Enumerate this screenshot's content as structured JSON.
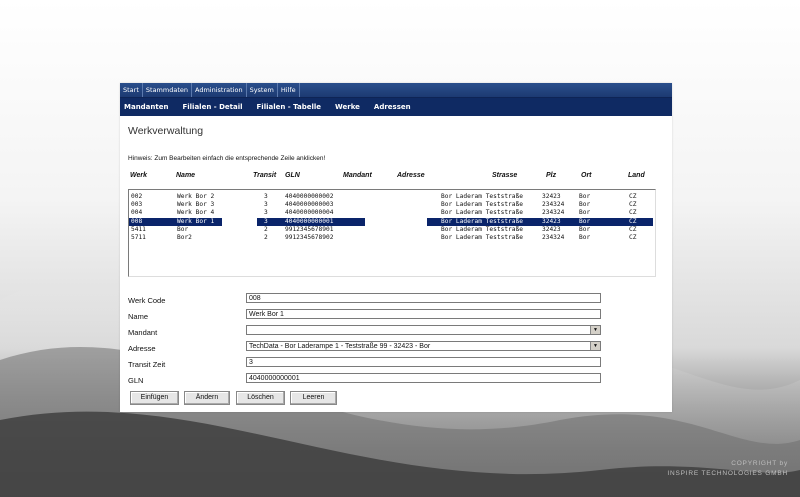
{
  "menu": [
    "Start",
    "Stammdaten",
    "Administration",
    "System",
    "Hilfe"
  ],
  "subnav": [
    "Mandanten",
    "Filialen - Detail",
    "Filialen - Tabelle",
    "Werke",
    "Adressen"
  ],
  "page": {
    "title": "Werkverwaltung",
    "hint": "Hinweis: Zum Bearbeiten einfach die entsprechende Zeile anklicken!"
  },
  "table": {
    "columns": [
      "Werk",
      "Name",
      "Transit",
      "GLN",
      "Mandant",
      "Adresse",
      "Strasse",
      "Plz",
      "Ort",
      "Land"
    ],
    "rows": [
      {
        "werk": "002",
        "name": "Werk Bor 2",
        "transit": "3",
        "gln": "4040000000002",
        "strasse": "Bor Laderam Teststraße",
        "plz": "32423",
        "ort": "Bor",
        "land": "CZ"
      },
      {
        "werk": "003",
        "name": "Werk Bor 3",
        "transit": "3",
        "gln": "4040000000003",
        "strasse": "Bor Laderam Teststraße",
        "plz": "234324",
        "ort": "Bor",
        "land": "CZ"
      },
      {
        "werk": "004",
        "name": "Werk Bor 4",
        "transit": "3",
        "gln": "4040000000004",
        "strasse": "Bor Laderam Teststraße",
        "plz": "234324",
        "ort": "Bor",
        "land": "CZ"
      },
      {
        "werk": "008",
        "name": "Werk Bor 1",
        "transit": "3",
        "gln": "4040000000001",
        "strasse": "Bor Laderam Teststraße",
        "plz": "32423",
        "ort": "Bor",
        "land": "CZ",
        "selected": true
      },
      {
        "werk": "5411",
        "name": "Bor",
        "transit": "2",
        "gln": "9912345678901",
        "strasse": "Bor Laderam Teststraße",
        "plz": "32423",
        "ort": "Bor",
        "land": "CZ"
      },
      {
        "werk": "5711",
        "name": "Bor2",
        "transit": "2",
        "gln": "9912345678902",
        "strasse": "Bor Laderam Teststraße",
        "plz": "234324",
        "ort": "Bor",
        "land": "CZ"
      }
    ]
  },
  "form": {
    "werk_code": {
      "label": "Werk Code",
      "value": "008"
    },
    "name": {
      "label": "Name",
      "value": "Werk Bor 1"
    },
    "mandant": {
      "label": "Mandant",
      "value": ""
    },
    "adresse": {
      "label": "Adresse",
      "value": "TechData - Bor Laderampe 1 - Teststraße 99 - 32423 - Bor"
    },
    "transit": {
      "label": "Transit Zeit",
      "value": "3"
    },
    "gln": {
      "label": "GLN",
      "value": "4040000000001"
    }
  },
  "buttons": {
    "insert": "Einfügen",
    "change": "Ändern",
    "delete": "Löschen",
    "clear": "Leeren"
  },
  "copyright": {
    "line1": "COPYRIGHT by",
    "line2": "INSPIRE TECHNOLOGIES GMBH"
  },
  "colors": {
    "menu_bg": "#1d3a72",
    "subnav_bg": "#0f2a63",
    "selection": "#0a246a"
  }
}
